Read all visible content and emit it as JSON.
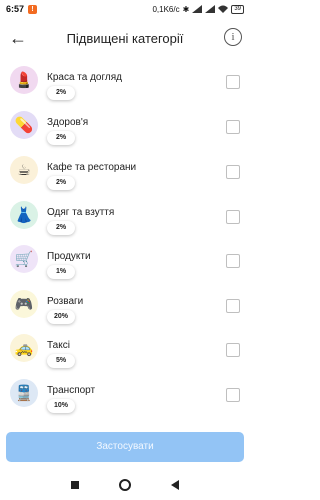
{
  "status": {
    "time": "6:57",
    "notification": "!",
    "speed": "0,1K6/c",
    "battery": "39"
  },
  "header": {
    "title": "Підвищені категорії",
    "back_glyph": "←",
    "info_glyph": "i"
  },
  "categories": [
    {
      "label": "Краса та догляд",
      "percent": "2%",
      "icon": "lipstick-icon",
      "glyph": "💄",
      "bg": "#f1d9f0"
    },
    {
      "label": "Здоров'я",
      "percent": "2%",
      "icon": "pill-icon",
      "glyph": "💊",
      "bg": "#e3dcf6"
    },
    {
      "label": "Кафе та ресторани",
      "percent": "2%",
      "icon": "coffee-cup-icon",
      "glyph": "☕",
      "bg": "#fbf1d9"
    },
    {
      "label": "Одяг та взуття",
      "percent": "2%",
      "icon": "dress-icon",
      "glyph": "👗",
      "bg": "#daf2e6"
    },
    {
      "label": "Продукти",
      "percent": "1%",
      "icon": "shopping-cart-icon",
      "glyph": "🛒",
      "bg": "#efe4f8"
    },
    {
      "label": "Розваги",
      "percent": "20%",
      "icon": "gamepad-icon",
      "glyph": "🎮",
      "bg": "#fbf7da"
    },
    {
      "label": "Таксі",
      "percent": "5%",
      "icon": "taxi-icon",
      "glyph": "🚕",
      "bg": "#fbf4d9"
    },
    {
      "label": "Транспорт",
      "percent": "10%",
      "icon": "train-icon",
      "glyph": "🚆",
      "bg": "#dde8f5"
    }
  ],
  "apply_button": {
    "label": "Застосувати",
    "color": "#93c4f5"
  }
}
